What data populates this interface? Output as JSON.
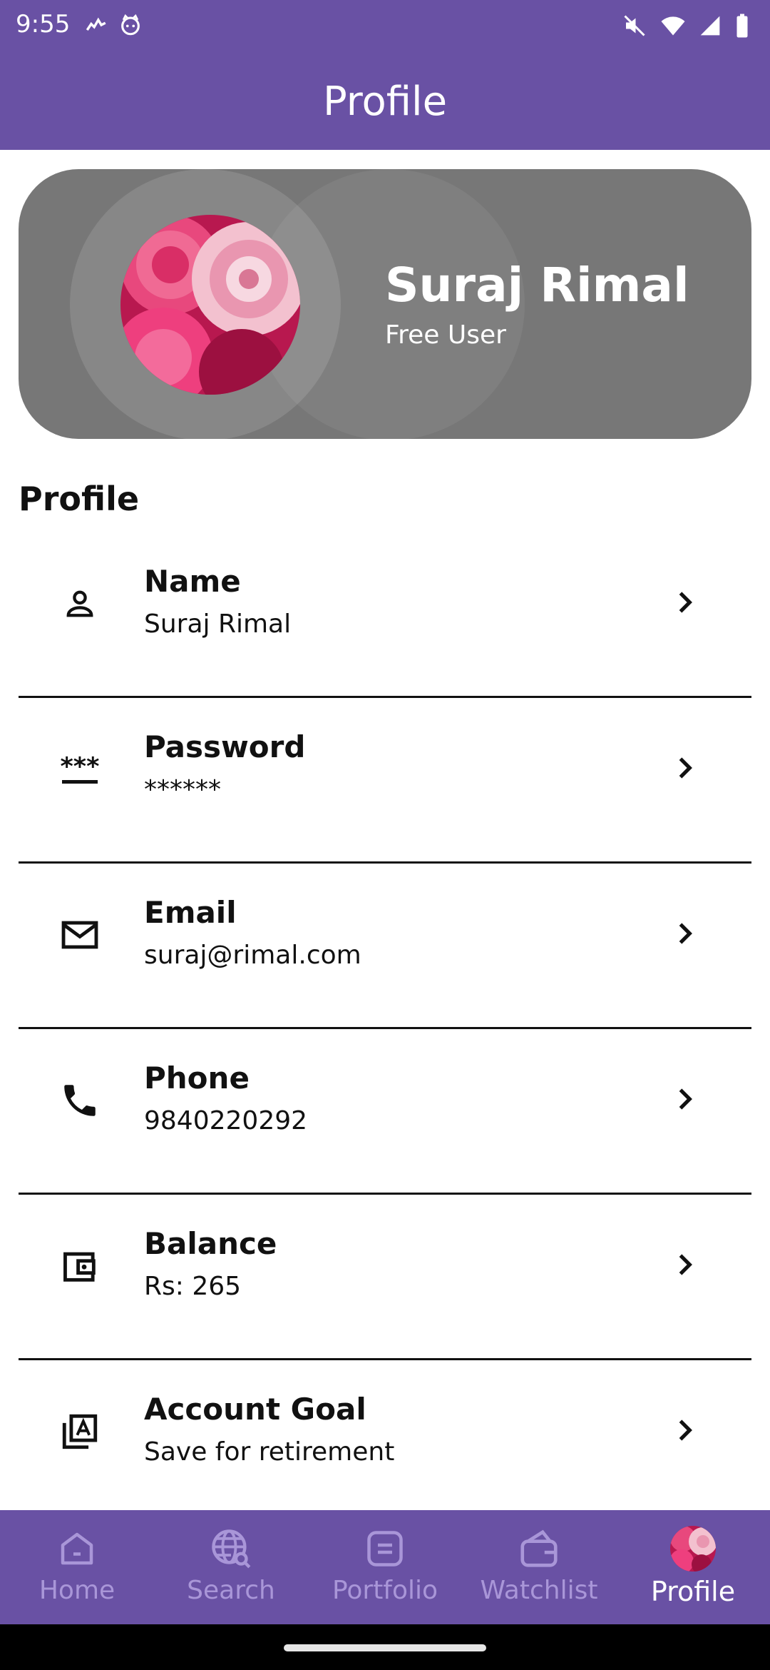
{
  "status": {
    "time": "9:55"
  },
  "appbar": {
    "title": "Profile"
  },
  "profile_card": {
    "name": "Suraj Rimal",
    "subtitle": "Free User",
    "avatar": "rose-photo"
  },
  "section_title": "Profile",
  "items": [
    {
      "icon": "person-icon",
      "label": "Name",
      "value": "Suraj Rimal"
    },
    {
      "icon": "password-icon",
      "label": "Password",
      "value": "******"
    },
    {
      "icon": "mail-icon",
      "label": "Email",
      "value": "suraj@rimal.com"
    },
    {
      "icon": "phone-icon",
      "label": "Phone",
      "value": "9840220292"
    },
    {
      "icon": "wallet-icon",
      "label": "Balance",
      "value": "Rs: 265"
    },
    {
      "icon": "assignment-icon",
      "label": "Account Goal",
      "value": "Save for retirement"
    }
  ],
  "nav": [
    {
      "label": "Home",
      "icon": "home-icon",
      "active": false
    },
    {
      "label": "Search",
      "icon": "globe-search-icon",
      "active": false
    },
    {
      "label": "Portfolio",
      "icon": "portfolio-icon",
      "active": false
    },
    {
      "label": "Watchlist",
      "icon": "wallet-icon",
      "active": false
    },
    {
      "label": "Profile",
      "icon": "avatar",
      "active": true
    }
  ],
  "colors": {
    "primary": "#6951a4",
    "card": "#777777",
    "nav_inactive": "#a996d8"
  }
}
